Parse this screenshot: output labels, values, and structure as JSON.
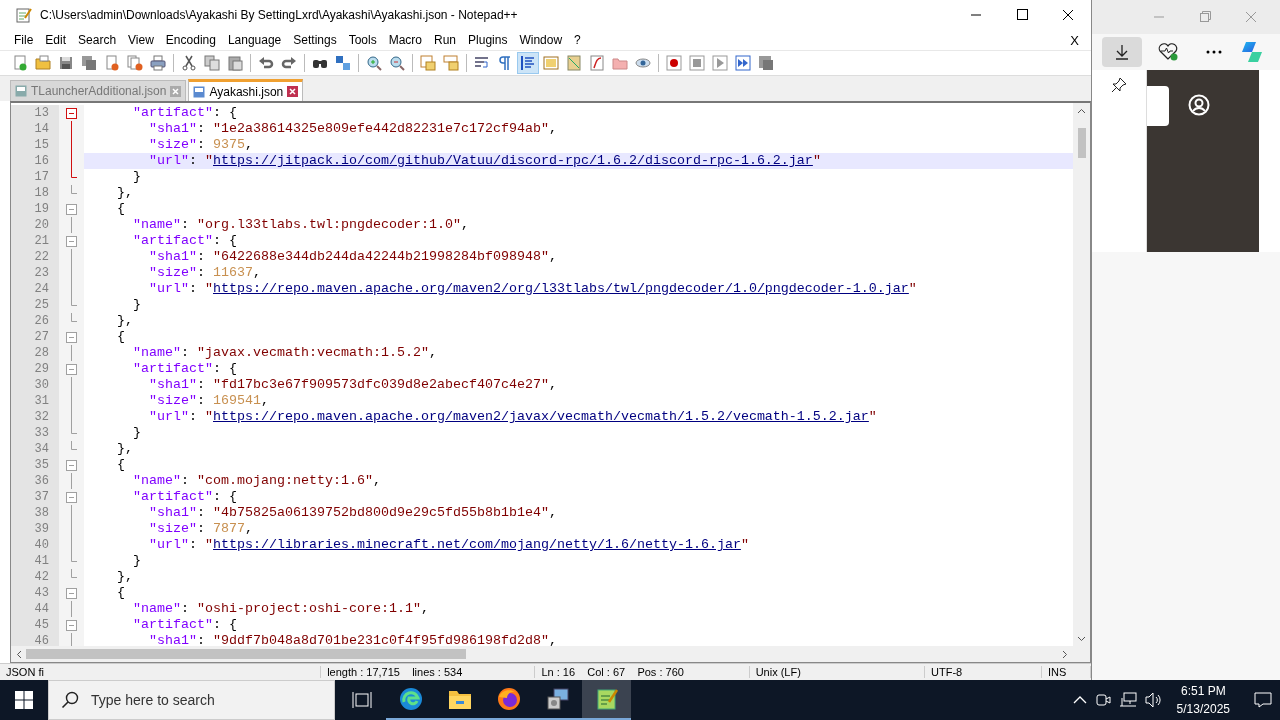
{
  "window": {
    "title": "C:\\Users\\admin\\Downloads\\Ayakashi By SettingLxrd\\Ayakashi\\Ayakashi.json - Notepad++",
    "close_doc": "X"
  },
  "menu": [
    "File",
    "Edit",
    "Search",
    "View",
    "Encoding",
    "Language",
    "Settings",
    "Tools",
    "Macro",
    "Run",
    "Plugins",
    "Window",
    "?"
  ],
  "toolbar": [
    {
      "kind": "new",
      "on": false
    },
    {
      "kind": "open",
      "on": false
    },
    {
      "kind": "save",
      "on": false
    },
    {
      "kind": "saveall",
      "on": false
    },
    {
      "kind": "close",
      "on": false
    },
    {
      "kind": "closeall",
      "on": false
    },
    {
      "kind": "print",
      "on": false
    },
    {
      "kind": "sep"
    },
    {
      "kind": "cut",
      "on": false
    },
    {
      "kind": "copy",
      "on": false
    },
    {
      "kind": "paste",
      "on": false
    },
    {
      "kind": "sep"
    },
    {
      "kind": "undo",
      "on": false
    },
    {
      "kind": "redo",
      "on": false
    },
    {
      "kind": "sep"
    },
    {
      "kind": "find",
      "on": false
    },
    {
      "kind": "replace",
      "on": false
    },
    {
      "kind": "sep"
    },
    {
      "kind": "zoomin",
      "on": false
    },
    {
      "kind": "zoomout",
      "on": false
    },
    {
      "kind": "sep"
    },
    {
      "kind": "syncv",
      "on": false
    },
    {
      "kind": "synch",
      "on": false
    },
    {
      "kind": "sep"
    },
    {
      "kind": "wrap",
      "on": false
    },
    {
      "kind": "allchars",
      "on": false
    },
    {
      "kind": "indent",
      "on": true
    },
    {
      "kind": "udl",
      "on": false
    },
    {
      "kind": "docmap",
      "on": false
    },
    {
      "kind": "funclist",
      "on": false
    },
    {
      "kind": "folder",
      "on": false
    },
    {
      "kind": "monitor",
      "on": false
    },
    {
      "kind": "sep"
    },
    {
      "kind": "record",
      "on": false
    },
    {
      "kind": "stop",
      "on": false
    },
    {
      "kind": "play",
      "on": false
    },
    {
      "kind": "playmulti",
      "on": false
    },
    {
      "kind": "savemacro",
      "on": false
    }
  ],
  "tabs": [
    {
      "label": "TLauncherAdditional.json",
      "selected": false
    },
    {
      "label": "Ayakashi.json",
      "selected": true
    }
  ],
  "lines": [
    {
      "number": "13",
      "code": "      \"artifact\": {",
      "kind": "open",
      "in_block": true,
      "current": false
    },
    {
      "number": "14",
      "code": "        \"sha1\": \"1e2a38614325e809efe442d82231e7c172cf94ab\",",
      "kind": "line",
      "in_block": true,
      "current": false
    },
    {
      "number": "15",
      "code": "        \"size\": 9375,",
      "kind": "line",
      "in_block": true,
      "current": false
    },
    {
      "number": "16",
      "code": "        \"url\": \"https://jitpack.io/com/github/Vatuu/discord-rpc/1.6.2/discord-rpc-1.6.2.jar\"",
      "kind": "line",
      "in_block": true,
      "current": true
    },
    {
      "number": "17",
      "code": "      }",
      "kind": "end",
      "in_block": true,
      "current": false
    },
    {
      "number": "18",
      "code": "    },",
      "kind": "end",
      "in_block": false,
      "current": false
    },
    {
      "number": "19",
      "code": "    {",
      "kind": "open",
      "in_block": false,
      "current": false
    },
    {
      "number": "20",
      "code": "      \"name\": \"org.l33tlabs.twl:pngdecoder:1.0\",",
      "kind": "line",
      "in_block": false,
      "current": false
    },
    {
      "number": "21",
      "code": "      \"artifact\": {",
      "kind": "open",
      "in_block": false,
      "current": false
    },
    {
      "number": "22",
      "code": "        \"sha1\": \"6422688e344db244da42244b21998284bf098948\",",
      "kind": "line",
      "in_block": false,
      "current": false
    },
    {
      "number": "23",
      "code": "        \"size\": 11637,",
      "kind": "line",
      "in_block": false,
      "current": false
    },
    {
      "number": "24",
      "code": "        \"url\": \"https://repo.maven.apache.org/maven2/org/l33tlabs/twl/pngdecoder/1.0/pngdecoder-1.0.jar\"",
      "kind": "line",
      "in_block": false,
      "current": false
    },
    {
      "number": "25",
      "code": "      }",
      "kind": "end",
      "in_block": false,
      "current": false
    },
    {
      "number": "26",
      "code": "    },",
      "kind": "end",
      "in_block": false,
      "current": false
    },
    {
      "number": "27",
      "code": "    {",
      "kind": "open",
      "in_block": false,
      "current": false
    },
    {
      "number": "28",
      "code": "      \"name\": \"javax.vecmath:vecmath:1.5.2\",",
      "kind": "line",
      "in_block": false,
      "current": false
    },
    {
      "number": "29",
      "code": "      \"artifact\": {",
      "kind": "open",
      "in_block": false,
      "current": false
    },
    {
      "number": "30",
      "code": "        \"sha1\": \"fd17bc3e67f909573dfc039d8e2abecf407c4e27\",",
      "kind": "line",
      "in_block": false,
      "current": false
    },
    {
      "number": "31",
      "code": "        \"size\": 169541,",
      "kind": "line",
      "in_block": false,
      "current": false
    },
    {
      "number": "32",
      "code": "        \"url\": \"https://repo.maven.apache.org/maven2/javax/vecmath/vecmath/1.5.2/vecmath-1.5.2.jar\"",
      "kind": "line",
      "in_block": false,
      "current": false
    },
    {
      "number": "33",
      "code": "      }",
      "kind": "end",
      "in_block": false,
      "current": false
    },
    {
      "number": "34",
      "code": "    },",
      "kind": "end",
      "in_block": false,
      "current": false
    },
    {
      "number": "35",
      "code": "    {",
      "kind": "open",
      "in_block": false,
      "current": false
    },
    {
      "number": "36",
      "code": "      \"name\": \"com.mojang:netty:1.6\",",
      "kind": "line",
      "in_block": false,
      "current": false
    },
    {
      "number": "37",
      "code": "      \"artifact\": {",
      "kind": "open",
      "in_block": false,
      "current": false
    },
    {
      "number": "38",
      "code": "        \"sha1\": \"4b75825a06139752bd800d9e29c5fd55b8b1b1e4\",",
      "kind": "line",
      "in_block": false,
      "current": false
    },
    {
      "number": "39",
      "code": "        \"size\": 7877,",
      "kind": "line",
      "in_block": false,
      "current": false
    },
    {
      "number": "40",
      "code": "        \"url\": \"https://libraries.minecraft.net/com/mojang/netty/1.6/netty-1.6.jar\"",
      "kind": "line",
      "in_block": false,
      "current": false
    },
    {
      "number": "41",
      "code": "      }",
      "kind": "end",
      "in_block": false,
      "current": false
    },
    {
      "number": "42",
      "code": "    },",
      "kind": "end",
      "in_block": false,
      "current": false
    },
    {
      "number": "43",
      "code": "    {",
      "kind": "open",
      "in_block": false,
      "current": false
    },
    {
      "number": "44",
      "code": "      \"name\": \"oshi-project:oshi-core:1.1\",",
      "kind": "line",
      "in_block": false,
      "current": false
    },
    {
      "number": "45",
      "code": "      \"artifact\": {",
      "kind": "open",
      "in_block": false,
      "current": false
    },
    {
      "number": "46",
      "code": "        \"sha1\": \"9ddf7b048a8d701be231c0f4f95fd986198fd2d8\",",
      "kind": "line",
      "in_block": false,
      "current": false
    }
  ],
  "status_bar": [
    "JSON fi",
    "length : 17,715    lines : 534",
    "Ln : 16    Col : 67    Pos : 760",
    "Unix (LF)",
    "UTF-8",
    "INS"
  ],
  "taskbar": {
    "search_placeholder": "Type here to search",
    "apps": [
      {
        "kind": "taskview",
        "running": false,
        "selected": false
      },
      {
        "kind": "edge",
        "running": true,
        "selected": false
      },
      {
        "kind": "explorer",
        "running": true,
        "selected": false
      },
      {
        "kind": "firefox",
        "running": true,
        "selected": false
      },
      {
        "kind": "installer",
        "running": true,
        "selected": false
      },
      {
        "kind": "notepad",
        "running": true,
        "selected": true
      }
    ],
    "time": "6:51 PM",
    "date": "5/13/2025"
  }
}
